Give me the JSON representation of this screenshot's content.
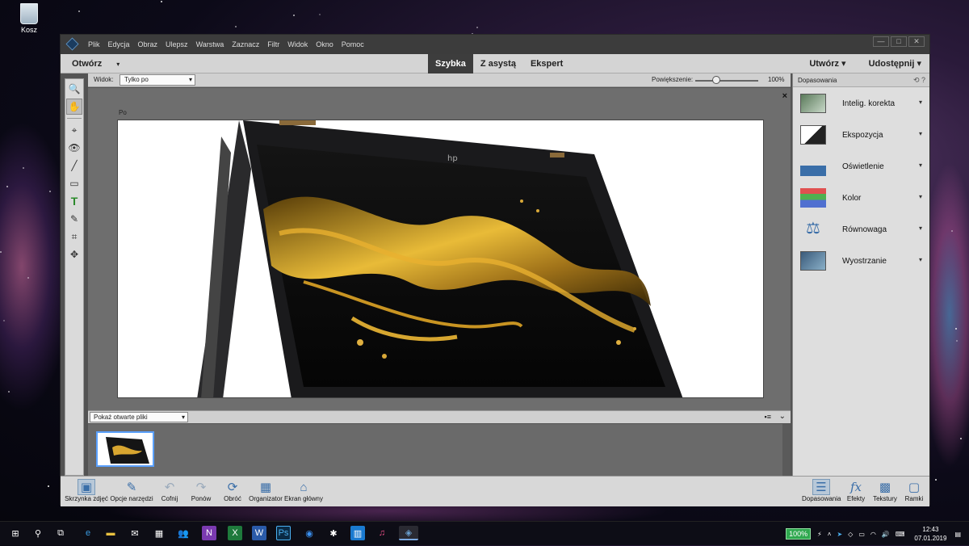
{
  "desktop": {
    "recycle_bin": "Kosz"
  },
  "menu": [
    "Plik",
    "Edycja",
    "Obraz",
    "Ulepsz",
    "Warstwa",
    "Zaznacz",
    "Filtr",
    "Widok",
    "Okno",
    "Pomoc"
  ],
  "window_controls": [
    "—",
    "□",
    "✕"
  ],
  "modebar": {
    "open": "Otwórz",
    "modes": [
      "Szybka",
      "Z asystą",
      "Ekspert"
    ],
    "active_mode": "Szybka",
    "create": "Utwórz ▾",
    "share": "Udostępnij ▾"
  },
  "viewbar": {
    "view_label": "Widok:",
    "view_value": "Tylko po",
    "zoom_label": "Powiększenie:",
    "zoom_value": "100%",
    "zoom_fraction": 0.33
  },
  "canvas": {
    "image_label": "Po",
    "close": "×"
  },
  "photo_bin": {
    "selector": "Pokaż otwarte pliki"
  },
  "panel": {
    "title": "Dopasowania",
    "items": [
      {
        "label": "Intelig. korekta",
        "icon": "smart-fix-icon"
      },
      {
        "label": "Ekspozycja",
        "icon": "exposure-icon"
      },
      {
        "label": "Oświetlenie",
        "icon": "lighting-icon"
      },
      {
        "label": "Kolor",
        "icon": "color-icon"
      },
      {
        "label": "Równowaga",
        "icon": "balance-icon"
      },
      {
        "label": "Wyostrzanie",
        "icon": "sharpen-icon"
      }
    ]
  },
  "bottombar": {
    "left": [
      {
        "label": "Skrzynka zdjęć",
        "icon": "photo-bin-icon"
      },
      {
        "label": "Opcje narzędzi",
        "icon": "tool-options-icon"
      },
      {
        "label": "Cofnij",
        "icon": "undo-icon"
      },
      {
        "label": "Ponów",
        "icon": "redo-icon"
      },
      {
        "label": "Obróć",
        "icon": "rotate-icon"
      },
      {
        "label": "Organizator",
        "icon": "organizer-icon"
      },
      {
        "label": "Ekran główny",
        "icon": "home-icon"
      }
    ],
    "right": [
      {
        "label": "Dopasowania",
        "icon": "adjustments-icon"
      },
      {
        "label": "Efekty",
        "icon": "effects-icon"
      },
      {
        "label": "Tekstury",
        "icon": "textures-icon"
      },
      {
        "label": "Ramki",
        "icon": "frames-icon"
      }
    ]
  },
  "taskbar": {
    "battery": "100%",
    "time": "12:43",
    "date": "07.01.2019"
  },
  "colors": {
    "accent": "#3a6ea8",
    "mode_active_bg": "#3d3d3d",
    "taskbar": "#0e0e16"
  }
}
